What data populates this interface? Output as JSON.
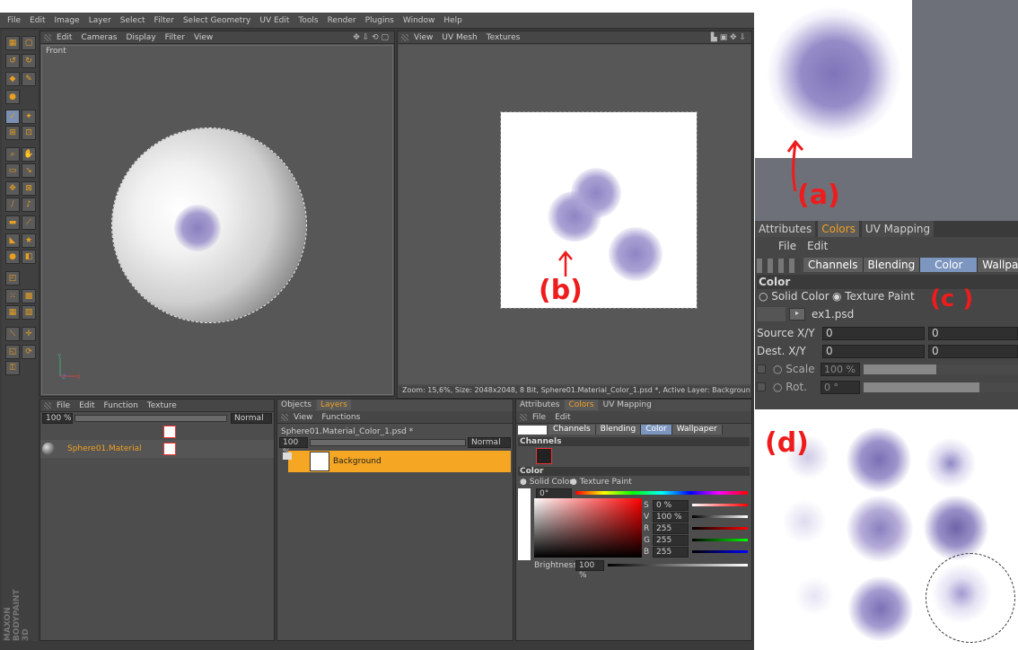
{
  "menu": [
    "File",
    "Edit",
    "Image",
    "Layer",
    "Select",
    "Filter",
    "Select Geometry",
    "UV Edit",
    "Tools",
    "Render",
    "Plugins",
    "Window",
    "Help"
  ],
  "brand": {
    "line1": "MAXON",
    "line2": "BODYPAINT 3D"
  },
  "viewport_left": {
    "menu": [
      "Edit",
      "Cameras",
      "Display",
      "Filter",
      "View"
    ],
    "label": "Front"
  },
  "viewport_right": {
    "menu": [
      "View",
      "UV Mesh",
      "Textures"
    ],
    "status": "Zoom: 15,6%, Size: 2048x2048, 8 Bit, Sphere01.Material_Color_1.psd *, Active Layer: Background"
  },
  "material_panel": {
    "menu": [
      "File",
      "Edit",
      "Function",
      "Texture"
    ],
    "zoom": "100 %",
    "mode": "Normal",
    "material": "Sphere01.Material"
  },
  "layers_panel": {
    "tabs": [
      "Objects",
      "Layers"
    ],
    "menu": [
      "View",
      "Functions"
    ],
    "file": "Sphere01.Material_Color_1.psd *",
    "zoom": "100 %",
    "mode": "Normal",
    "layer": "Background"
  },
  "attr_small": {
    "tabs": [
      "Attributes",
      "Colors",
      "UV Mapping"
    ],
    "menu": [
      "File",
      "Edit"
    ],
    "segments": [
      "Channels",
      "Blending",
      "Color",
      "Wallpaper"
    ],
    "channels": "Channels",
    "color": "Color",
    "solid": "Solid Color",
    "texture": "Texture Paint",
    "hue": "0°",
    "S": "0 %",
    "V": "100 %",
    "R": "255",
    "G": "255",
    "B": "255",
    "brightness_label": "Brightness",
    "brightness": "100 %"
  },
  "zoom_attr": {
    "tabs": [
      "Attributes",
      "Colors",
      "UV Mapping"
    ],
    "menu": [
      "File",
      "Edit"
    ],
    "segments": [
      "Channels",
      "Blending",
      "Color",
      "Wallpaper"
    ],
    "section": "Color",
    "solid": "Solid Color",
    "texture": "Texture Paint",
    "file": "ex1.psd",
    "source_label": "Source X/Y",
    "dest_label": "Dest. X/Y",
    "src_x": "0",
    "src_y": "0",
    "dst_x": "0",
    "dst_y": "0",
    "scale_label": "Scale",
    "scale": "100 %",
    "rot_label": "Rot.",
    "rot": "0 °"
  },
  "annotations": {
    "a": "(a)",
    "b": "(b)",
    "c": "(c )",
    "d": "(d)"
  },
  "colors": {
    "accent": "#f0a020",
    "selected_tab": "#7d96bf",
    "paint": "#8e85c4",
    "annotation": "#ee1c1c"
  }
}
